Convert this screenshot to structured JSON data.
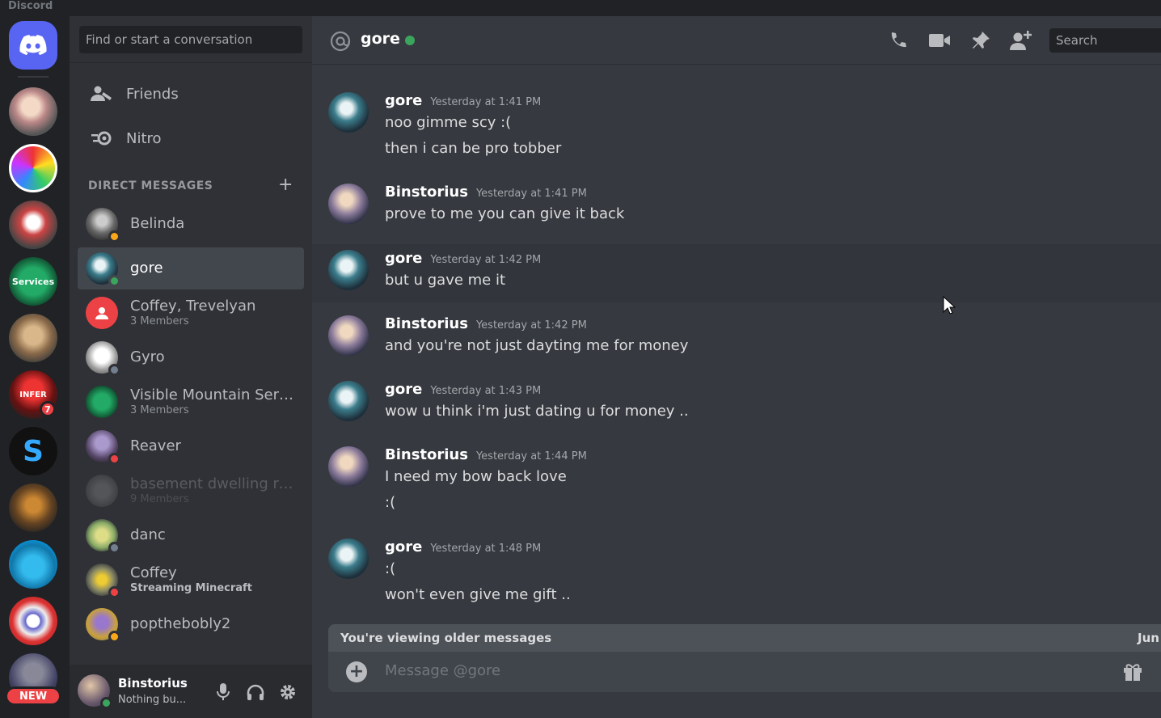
{
  "app": {
    "title": "Discord"
  },
  "rail": {
    "new_label": "NEW",
    "badge_count": "7",
    "services_label": "Services",
    "infer_label": "INFER"
  },
  "sidebar": {
    "search_placeholder": "Find or start a conversation",
    "nav": [
      {
        "label": "Friends",
        "icon": "friends-icon"
      },
      {
        "label": "Nitro",
        "icon": "nitro-icon"
      }
    ],
    "dm_header": "DIRECT MESSAGES",
    "dms": [
      {
        "name": "Belinda",
        "sub": "",
        "status": "idle"
      },
      {
        "name": "gore",
        "sub": "",
        "status": "online",
        "active": true
      },
      {
        "name": "Coffey, Trevelyan",
        "sub": "3 Members",
        "status": "group"
      },
      {
        "name": "Gyro",
        "sub": "",
        "status": "offline"
      },
      {
        "name": "Visible Mountain Servi...",
        "sub": "3 Members",
        "status": "group"
      },
      {
        "name": "Reaver",
        "sub": "",
        "status": "dnd"
      },
      {
        "name": "basement dwelling ret...",
        "sub": "9 Members",
        "status": "group"
      },
      {
        "name": "danc",
        "sub": "",
        "status": "offline"
      },
      {
        "name": "Coffey",
        "sub": "Streaming Minecraft",
        "status": "dnd"
      },
      {
        "name": "poptheboblу2",
        "sub": "",
        "status": "idle"
      }
    ],
    "user": {
      "name": "Binstorius",
      "status": "Nothing bu..."
    }
  },
  "chat": {
    "channel": "gore",
    "search_placeholder": "Search",
    "messages": [
      {
        "author": "gore",
        "time": "Yesterday at 1:41 PM",
        "lines": [
          "noo gimme scy :(",
          "then i can be pro tobber"
        ]
      },
      {
        "author": "Binstorius",
        "time": "Yesterday at 1:41 PM",
        "lines": [
          "prove to me you can give it back"
        ]
      },
      {
        "author": "gore",
        "time": "Yesterday at 1:42 PM",
        "lines": [
          "but u gave me it"
        ]
      },
      {
        "author": "Binstorius",
        "time": "Yesterday at 1:42 PM",
        "lines": [
          "and you're not just dayting me for money"
        ]
      },
      {
        "author": "gore",
        "time": "Yesterday at 1:43 PM",
        "lines": [
          "wow u think i'm just dating u for money .."
        ]
      },
      {
        "author": "Binstorius",
        "time": "Yesterday at 1:44 PM",
        "lines": [
          "I need my bow back love",
          ":("
        ]
      },
      {
        "author": "gore",
        "time": "Yesterday at 1:48 PM",
        "lines": [
          ":(",
          "won't even give me gift .."
        ]
      }
    ],
    "older_notice": "You're viewing older messages",
    "jump_label": "Jun",
    "composer_placeholder": "Message @gore"
  },
  "colors": {
    "blurple": "#5865f2",
    "online": "#3ba55d",
    "idle": "#faa81a",
    "dnd": "#ed4245",
    "offline": "#747f8d"
  }
}
